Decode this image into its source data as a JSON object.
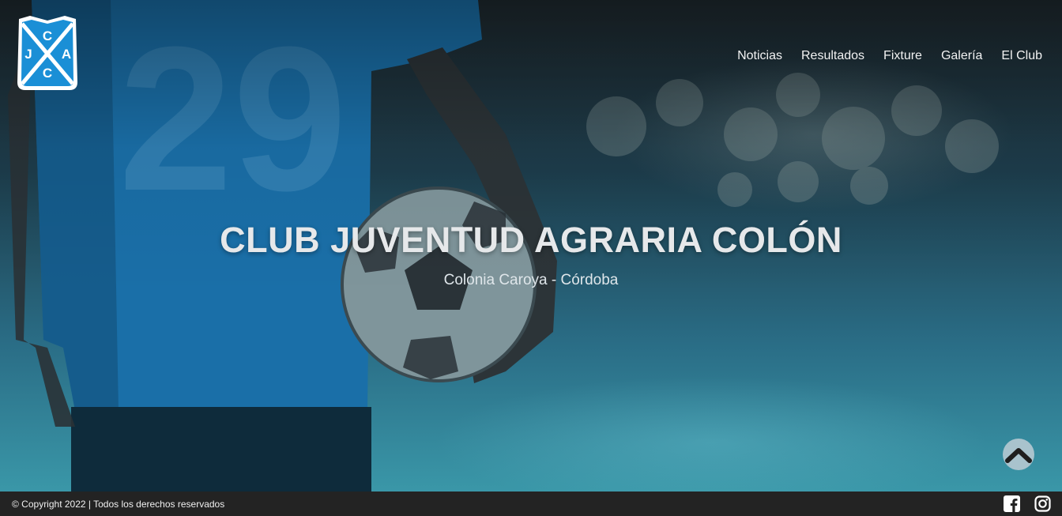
{
  "logo": {
    "letters": [
      "C",
      "J",
      "A",
      "C"
    ]
  },
  "nav": {
    "items": [
      "Noticias",
      "Resultados",
      "Fixture",
      "Galería",
      "El Club"
    ]
  },
  "hero": {
    "title": "CLUB JUVENTUD AGRARIA COLÓN",
    "subtitle": "Colonia Caroya - Córdoba",
    "jersey_number": "29"
  },
  "footer": {
    "copyright": "© Copyright 2022 | Todos los derechos reservados",
    "social": [
      "facebook-icon",
      "instagram-icon"
    ]
  },
  "colors": {
    "accent": "#1a8fd6",
    "footer_bg": "#232323",
    "logo_blue": "#1a8fd6"
  }
}
